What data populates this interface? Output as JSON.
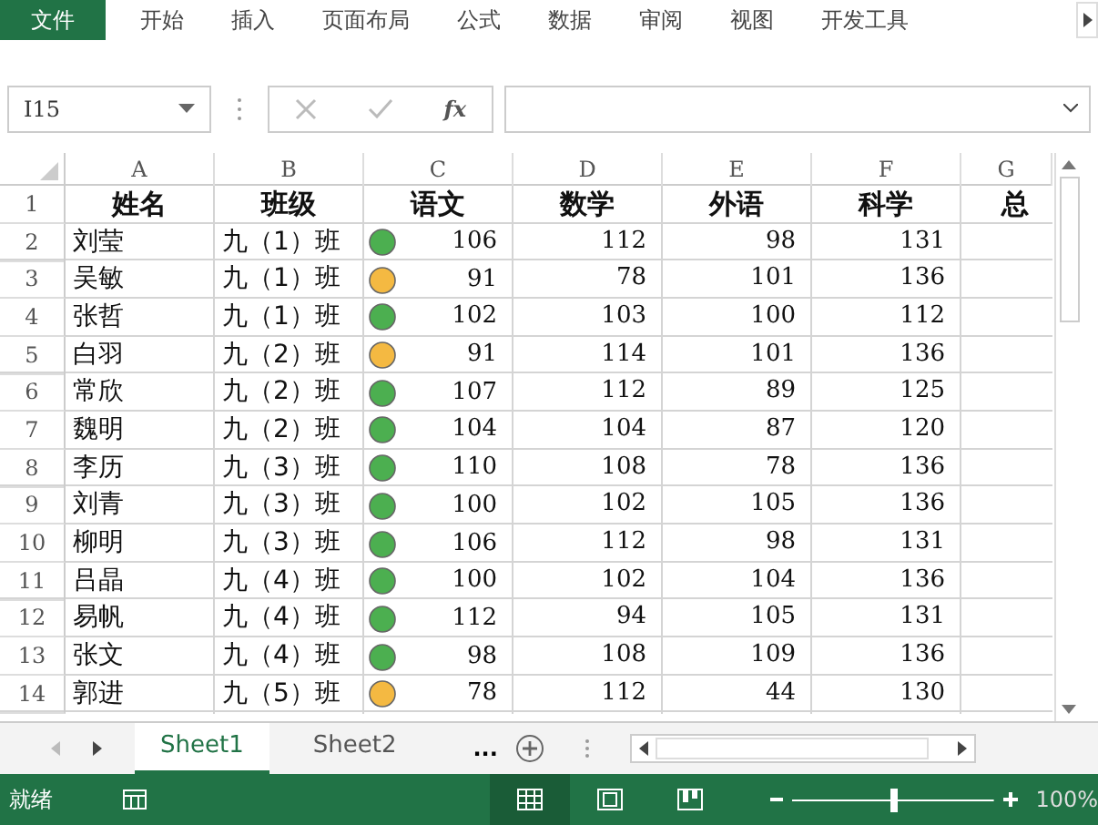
{
  "ribbon_tabs": [
    {
      "label": "文件",
      "selected": true
    },
    {
      "label": "开始",
      "selected": false
    },
    {
      "label": "插入",
      "selected": false
    },
    {
      "label": "页面布局",
      "selected": false
    },
    {
      "label": "公式",
      "selected": false
    },
    {
      "label": "数据",
      "selected": false
    },
    {
      "label": "审阅",
      "selected": false
    },
    {
      "label": "视图",
      "selected": false
    },
    {
      "label": "开发工具",
      "selected": false
    }
  ],
  "formula_bar": {
    "name_box": "I15",
    "function_label": "fx"
  },
  "columns": [
    "A",
    "B",
    "C",
    "D",
    "E",
    "F",
    "G"
  ],
  "header_row": {
    "number": "1",
    "cells": [
      "姓名",
      "班级",
      "语文",
      "数学",
      "外语",
      "科学",
      "总"
    ]
  },
  "rows": [
    {
      "number": "2",
      "name": "刘莹",
      "class": "九（1）班",
      "color": "#4caf50",
      "scores": [
        "106",
        "112",
        "98",
        "131"
      ]
    },
    {
      "number": "3",
      "name": "吴敏",
      "class": "九（1）班",
      "color": "#f4b942",
      "scores": [
        "91",
        "78",
        "101",
        "136"
      ]
    },
    {
      "number": "4",
      "name": "张哲",
      "class": "九（1）班",
      "color": "#4caf50",
      "scores": [
        "102",
        "103",
        "100",
        "112"
      ]
    },
    {
      "number": "5",
      "name": "白羽",
      "class": "九（2）班",
      "color": "#f4b942",
      "scores": [
        "91",
        "114",
        "101",
        "136"
      ]
    },
    {
      "number": "6",
      "name": "常欣",
      "class": "九（2）班",
      "color": "#4caf50",
      "scores": [
        "107",
        "112",
        "89",
        "125"
      ]
    },
    {
      "number": "7",
      "name": "魏明",
      "class": "九（2）班",
      "color": "#4caf50",
      "scores": [
        "104",
        "104",
        "87",
        "120"
      ]
    },
    {
      "number": "8",
      "name": "李历",
      "class": "九（3）班",
      "color": "#4caf50",
      "scores": [
        "110",
        "108",
        "78",
        "136"
      ]
    },
    {
      "number": "9",
      "name": "刘青",
      "class": "九（3）班",
      "color": "#4caf50",
      "scores": [
        "100",
        "102",
        "105",
        "136"
      ]
    },
    {
      "number": "10",
      "name": "柳明",
      "class": "九（3）班",
      "color": "#4caf50",
      "scores": [
        "106",
        "112",
        "98",
        "131"
      ]
    },
    {
      "number": "11",
      "name": "吕晶",
      "class": "九（4）班",
      "color": "#4caf50",
      "scores": [
        "100",
        "102",
        "104",
        "136"
      ]
    },
    {
      "number": "12",
      "name": "易帆",
      "class": "九（4）班",
      "color": "#4caf50",
      "scores": [
        "112",
        "94",
        "105",
        "131"
      ]
    },
    {
      "number": "13",
      "name": "张文",
      "class": "九（4）班",
      "color": "#4caf50",
      "scores": [
        "98",
        "108",
        "109",
        "136"
      ]
    },
    {
      "number": "14",
      "name": "郭进",
      "class": "九（5）班",
      "color": "#f4b942",
      "scores": [
        "78",
        "112",
        "44",
        "130"
      ]
    }
  ],
  "sheet_tabs": [
    {
      "label": "Sheet1",
      "selected": true
    },
    {
      "label": "Sheet2",
      "selected": false
    }
  ],
  "sheet_more": "...",
  "status_bar": {
    "status": "就绪",
    "zoom": {
      "level": 0.5
    },
    "zoom_label": "100%"
  }
}
